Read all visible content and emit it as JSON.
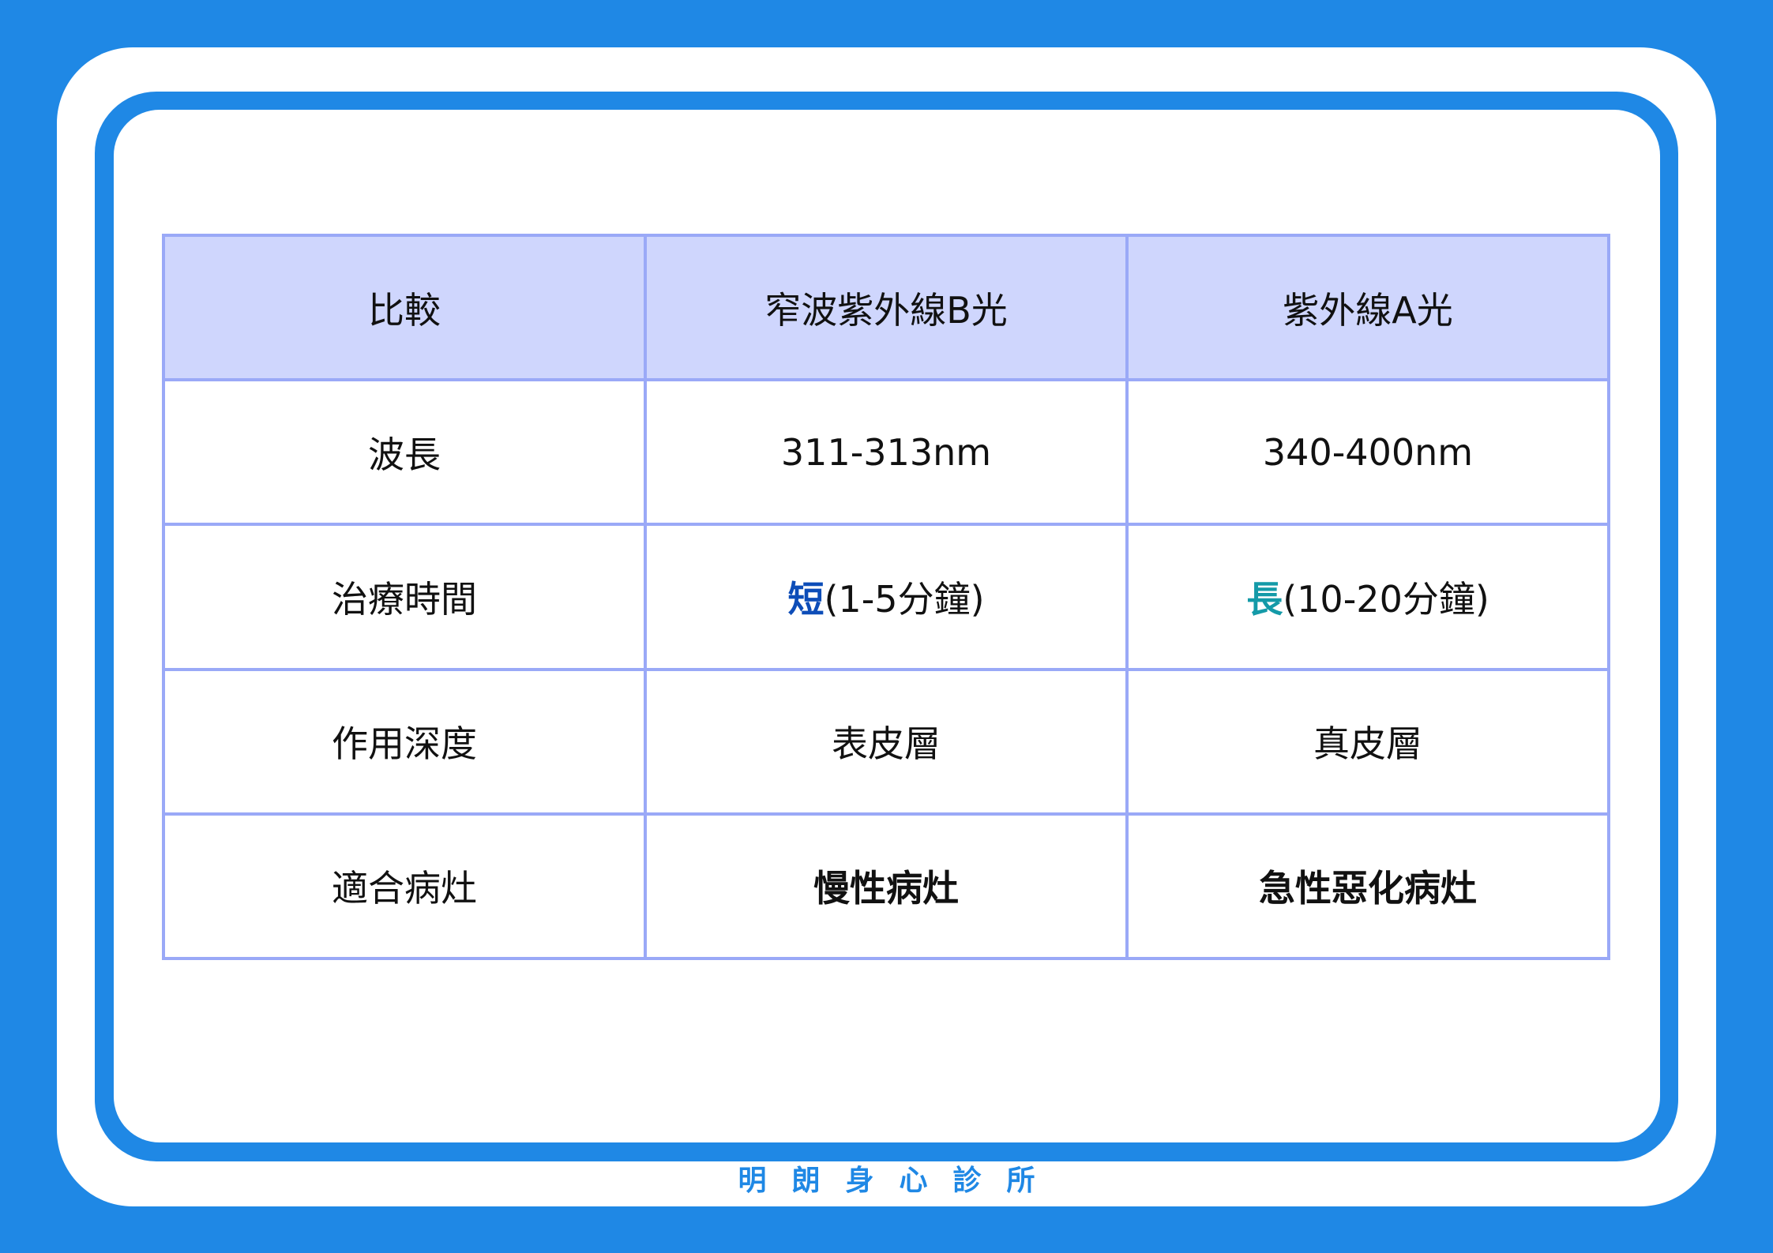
{
  "table": {
    "header": {
      "compare": "比較",
      "uvb": "窄波紫外線B光",
      "uva": "紫外線A光"
    },
    "rows": [
      {
        "label": "波長",
        "uvb": "311-313nm",
        "uva": "340-400nm"
      },
      {
        "label": "治療時間",
        "uvb_strong": "短",
        "uvb_rest": "(1-5分鐘)",
        "uva_strong": "長",
        "uva_rest": "(10-20分鐘)"
      },
      {
        "label": "作用深度",
        "uvb": "表皮層",
        "uva": "真皮層"
      },
      {
        "label": "適合病灶",
        "uvb": "慢性病灶",
        "uva": "急性惡化病灶"
      }
    ]
  },
  "footer": {
    "text": "明朗身心診所"
  },
  "colors": {
    "background": "#1f88e5",
    "header_fill": "#cfd6fd",
    "border": "#9aa9f7",
    "uvb_accent": "#0d4db8",
    "uva_accent": "#149aa8"
  }
}
